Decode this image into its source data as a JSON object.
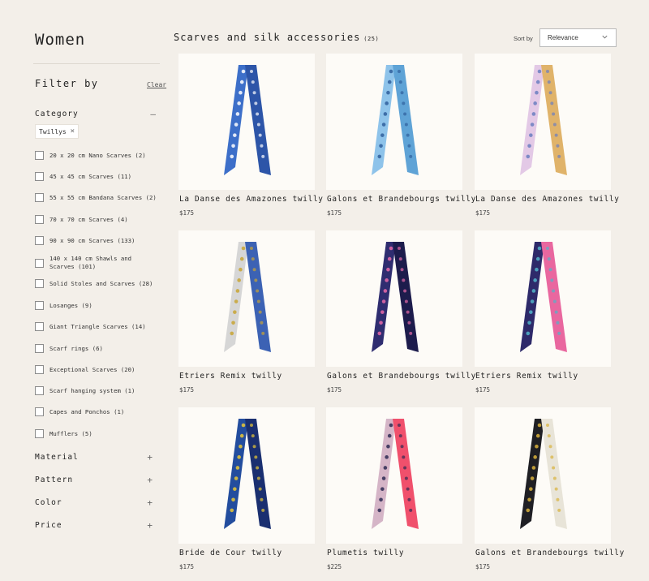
{
  "sidebar": {
    "title": "Women",
    "filter_label": "Filter by",
    "clear_label": "Clear",
    "category_label": "Category",
    "category_sign": "–",
    "active_filter": "Twillys",
    "options": [
      "20 x 20 cm Nano Scarves (2)",
      "45 x 45 cm Scarves (11)",
      "55 x 55 cm Bandana Scarves (2)",
      "70 x 70 cm Scarves (4)",
      "90 x 90 cm Scarves (133)",
      "140 x 140 cm Shawls and Scarves (101)",
      "Solid Stoles and Scarves (28)",
      "Losanges (9)",
      "Giant Triangle Scarves (14)",
      "Scarf rings (6)",
      "Exceptional Scarves (20)",
      "Scarf hanging system (1)",
      "Capes and Ponchos (1)",
      "Mufflers (5)"
    ],
    "sections": [
      {
        "label": "Material",
        "sign": "+"
      },
      {
        "label": "Pattern",
        "sign": "+"
      },
      {
        "label": "Color",
        "sign": "+"
      },
      {
        "label": "Price",
        "sign": "+"
      }
    ]
  },
  "main": {
    "title": "Scarves and silk accessories",
    "count": "(25)",
    "sort_label": "Sort by",
    "sort_value": "Relevance"
  },
  "products": [
    {
      "name": "La Danse des Amazones twilly",
      "price": "$175",
      "c1": "#3d6fc9",
      "c2": "#2d55a8",
      "acc": "#ffffff"
    },
    {
      "name": "Galons et Brandebourgs twilly",
      "price": "$175",
      "c1": "#8ec3ea",
      "c2": "#5fa3d6",
      "acc": "#2f5f9c"
    },
    {
      "name": "La Danse des Amazones twilly",
      "price": "$175",
      "c1": "#e3c9e6",
      "c2": "#e0b36a",
      "acc": "#6b7fc0"
    },
    {
      "name": "Etriers Remix twilly",
      "price": "$175",
      "c1": "#d6d6d6",
      "c2": "#3c62b4",
      "acc": "#c8a434"
    },
    {
      "name": "Galons et Brandebourgs twilly",
      "price": "$175",
      "c1": "#2f2d70",
      "c2": "#1d1c4c",
      "acc": "#e76aa8"
    },
    {
      "name": "Etriers Remix twilly",
      "price": "$175",
      "c1": "#2e2a6a",
      "c2": "#e9679f",
      "acc": "#51b4c9"
    },
    {
      "name": "Bride de Cour twilly",
      "price": "$175",
      "c1": "#234d9e",
      "c2": "#1a2f70",
      "acc": "#e8c836"
    },
    {
      "name": "Plumetis twilly",
      "price": "$225",
      "c1": "#d5b5c7",
      "c2": "#f0506c",
      "acc": "#2d2a52"
    },
    {
      "name": "Galons et Brandebourgs twilly",
      "price": "$175",
      "c1": "#1f1f24",
      "c2": "#e8e4d8",
      "acc": "#d9b23c"
    }
  ]
}
